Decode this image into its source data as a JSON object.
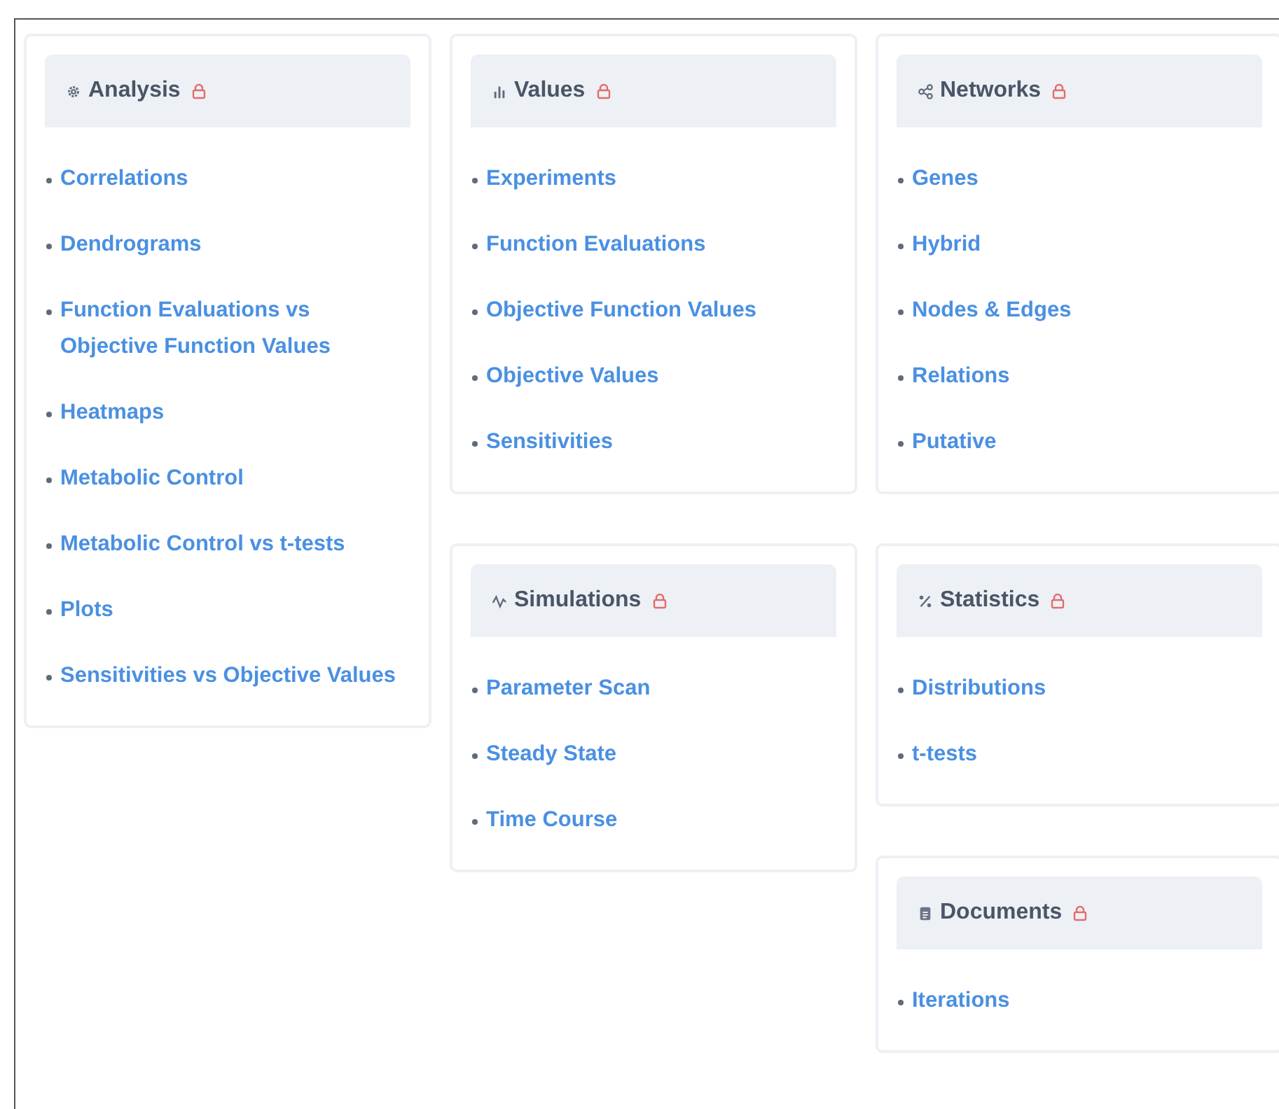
{
  "columns": [
    {
      "cards": [
        {
          "title": "Analysis",
          "kind": "gear",
          "locked": true,
          "items": [
            "Correlations",
            "Dendrograms",
            "Function Evaluations vs Objective Function Values",
            "Heatmaps",
            "Metabolic Control",
            "Metabolic Control vs t-tests",
            "Plots",
            "Sensitivities vs Objective Values"
          ]
        }
      ]
    },
    {
      "cards": [
        {
          "title": "Values",
          "kind": "bars",
          "locked": true,
          "items": [
            "Experiments",
            "Function Evaluations",
            "Objective Function Values",
            "Objective Values",
            "Sensitivities"
          ]
        },
        {
          "title": "Simulations",
          "kind": "pulse",
          "locked": true,
          "items": [
            "Parameter Scan",
            "Steady State",
            "Time Course"
          ]
        }
      ]
    },
    {
      "cards": [
        {
          "title": "Networks",
          "kind": "share",
          "locked": true,
          "items": [
            "Genes",
            "Hybrid",
            "Nodes & Edges",
            "Relations",
            "Putative"
          ]
        },
        {
          "title": "Statistics",
          "kind": "percent",
          "locked": true,
          "items": [
            "Distributions",
            "t-tests"
          ]
        },
        {
          "title": "Documents",
          "kind": "document",
          "locked": true,
          "items": [
            "Iterations"
          ]
        }
      ]
    }
  ]
}
